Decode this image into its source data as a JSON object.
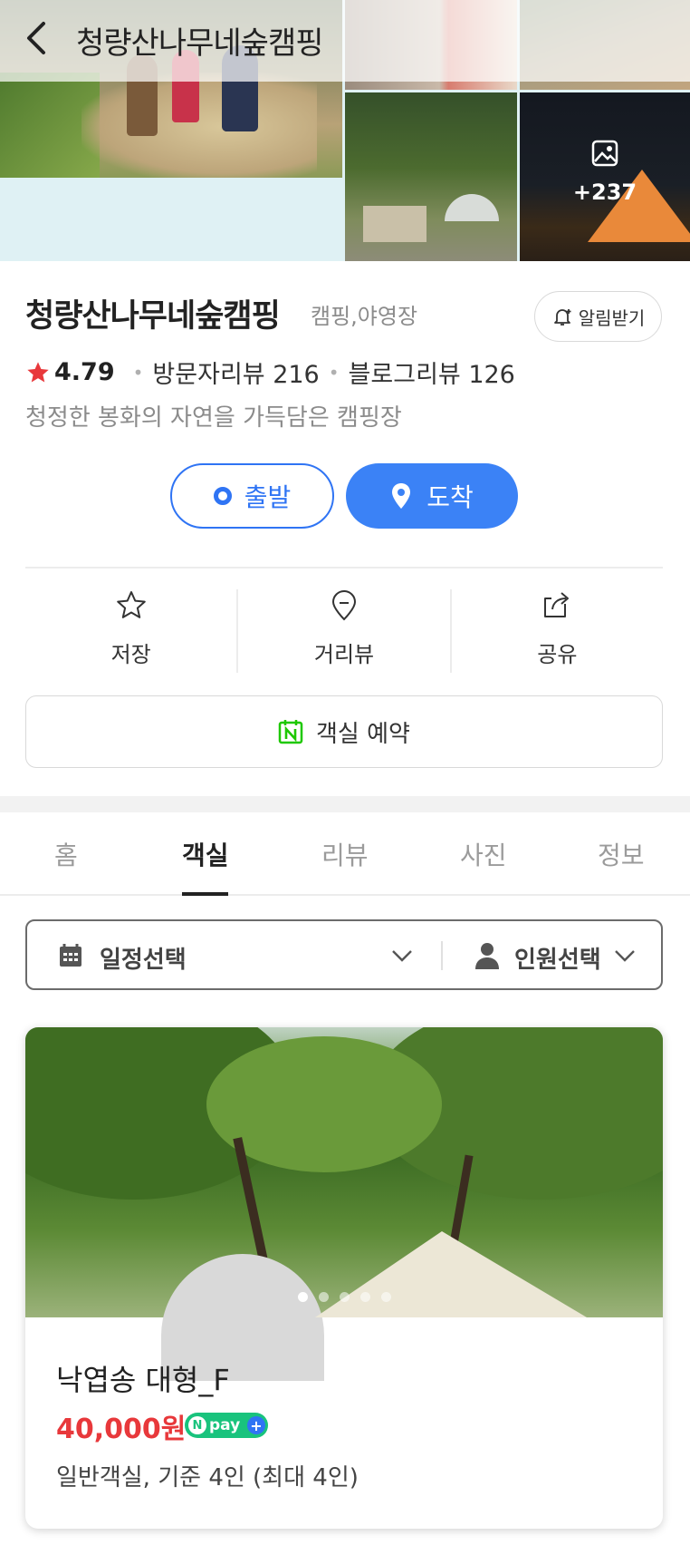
{
  "header": {
    "title": "청량산나무네숲캠핑",
    "more_photos": "+237"
  },
  "place": {
    "name": "청량산나무네숲캠핑",
    "category": "캠핑,야영장",
    "alarm_label": "알림받기",
    "rating": "4.79",
    "visitor_reviews": "방문자리뷰 216",
    "blog_reviews": "블로그리뷰 126",
    "description": "청정한 봉화의 자연을 가득담은 캠핑장"
  },
  "route": {
    "start_label": "출발",
    "end_label": "도착"
  },
  "actions": {
    "save_label": "저장",
    "street_view_label": "거리뷰",
    "share_label": "공유"
  },
  "reserve": {
    "label": "객실 예약"
  },
  "tabs": [
    {
      "label": "홈"
    },
    {
      "label": "객실"
    },
    {
      "label": "리뷰"
    },
    {
      "label": "사진"
    },
    {
      "label": "정보"
    }
  ],
  "active_tab": "객실",
  "filter": {
    "date_label": "일정선택",
    "people_label": "인원선택"
  },
  "room": {
    "name": "낙엽송 대형_F",
    "price": "40,000원",
    "npay_label": "pay",
    "description": "일반객실, 기준 4인 (최대 4인)",
    "image_count": 5,
    "current_image": 1
  },
  "colors": {
    "accent": "#3b82f6",
    "price": "#e8383b",
    "star": "#e8383b",
    "npay": "#19c37d",
    "naver_green": "#1ec800"
  }
}
